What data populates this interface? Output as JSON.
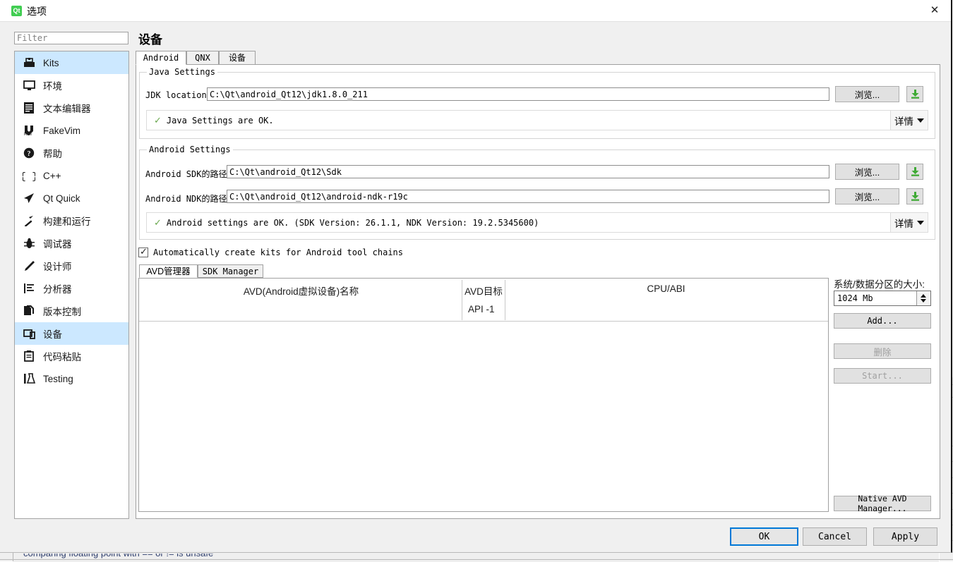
{
  "window": {
    "title": "选项",
    "icon": "qt-logo-icon",
    "close_label": "✕"
  },
  "filter": {
    "placeholder": "Filter",
    "value": ""
  },
  "sidebar": {
    "items": [
      {
        "label": "Kits",
        "icon": "kits-icon",
        "selected": true
      },
      {
        "label": "环境",
        "icon": "monitor-icon",
        "selected": false
      },
      {
        "label": "文本编辑器",
        "icon": "text-editor-icon",
        "selected": false
      },
      {
        "label": "FakeVim",
        "icon": "fakevim-icon",
        "selected": false
      },
      {
        "label": "帮助",
        "icon": "help-icon",
        "selected": false
      },
      {
        "label": "C++",
        "icon": "braces-icon",
        "selected": false
      },
      {
        "label": "Qt Quick",
        "icon": "paper-plane-icon",
        "selected": false
      },
      {
        "label": "构建和运行",
        "icon": "hammer-icon",
        "selected": false
      },
      {
        "label": "调试器",
        "icon": "bug-icon",
        "selected": false
      },
      {
        "label": "设计师",
        "icon": "pencil-icon",
        "selected": false
      },
      {
        "label": "分析器",
        "icon": "analyzer-icon",
        "selected": false
      },
      {
        "label": "版本控制",
        "icon": "version-control-icon",
        "selected": false
      },
      {
        "label": "设备",
        "icon": "device-icon",
        "selected": true
      },
      {
        "label": "代码粘贴",
        "icon": "clipboard-icon",
        "selected": false
      },
      {
        "label": "Testing",
        "icon": "testing-icon",
        "selected": false
      }
    ]
  },
  "page": {
    "title": "设备",
    "tabs": [
      {
        "label": "Android",
        "active": true
      },
      {
        "label": "QNX",
        "active": false
      },
      {
        "label": "设备",
        "active": false
      }
    ]
  },
  "java_settings": {
    "group_title": "Java Settings",
    "jdk_label": "JDK location:",
    "jdk_value": "C:\\Qt\\android_Qt12\\jdk1.8.0_211",
    "browse_label": "浏览...",
    "download_icon": "download-icon",
    "status_icon": "check-icon",
    "status_text": "Java Settings are OK.",
    "details_label": "详情"
  },
  "android_settings": {
    "group_title": "Android Settings",
    "sdk_label": "Android SDK的路径:",
    "sdk_value": "C:\\Qt\\android_Qt12\\Sdk",
    "ndk_label": "Android NDK的路径:",
    "ndk_value": "C:\\Qt\\android_Qt12\\android-ndk-r19c",
    "browse_label": "浏览...",
    "download_icon": "download-icon",
    "status_icon": "check-icon",
    "status_text": "Android settings are OK. (SDK Version: 26.1.1, NDK Version: 19.2.5345600)",
    "details_label": "详情"
  },
  "auto_kits": {
    "label": "Automatically create kits for Android tool chains",
    "checked": true
  },
  "inner_tabs": [
    {
      "label": "AVD管理器",
      "active": true
    },
    {
      "label": "SDK Manager",
      "active": false
    }
  ],
  "avd_table": {
    "columns": [
      {
        "header": "AVD(Android虚拟设备)名称",
        "subheader": ""
      },
      {
        "header": "AVD目标",
        "subheader": "API -1"
      },
      {
        "header": "CPU/ABI",
        "subheader": ""
      }
    ],
    "rows": []
  },
  "avd_panel": {
    "partition_label": "系统/数据分区的大小:",
    "partition_value": "1024 Mb",
    "add_label": "Add...",
    "delete_label": "删除",
    "start_label": "Start...",
    "native_label": "Native AVD Manager...",
    "delete_disabled": true,
    "start_disabled": true
  },
  "dialog_buttons": {
    "ok": "OK",
    "cancel": "Cancel",
    "apply": "Apply"
  },
  "background": {
    "footer_text": "comparing floating point with == or != is unsafe"
  },
  "colors": {
    "accent": "#0078d7",
    "selection": "#cce8ff",
    "ok_green": "#6aa84f",
    "marker_blue": "#0b7ad5",
    "qt_green": "#41cd52"
  }
}
